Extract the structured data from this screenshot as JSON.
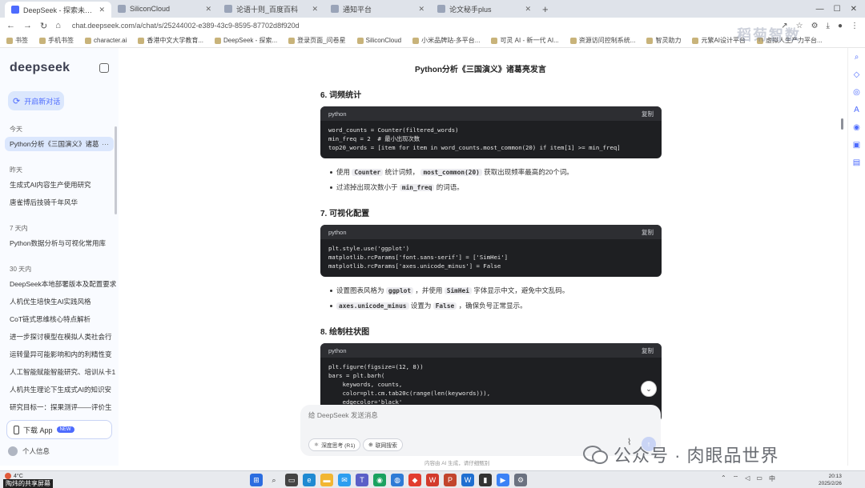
{
  "browser": {
    "tabs": [
      {
        "title": "DeepSeek - 探索未至之境",
        "active": true
      },
      {
        "title": "SiliconCloud",
        "active": false
      },
      {
        "title": "论语十则_百度百科",
        "active": false
      },
      {
        "title": "通知平台",
        "active": false
      },
      {
        "title": "论文秘手plus",
        "active": false
      }
    ],
    "tab_close": "✕",
    "new_tab": "+",
    "url": "chat.deepseek.com/a/chat/s/25244002-e389-43c9-8595-87702d8f920d",
    "bookmarks": [
      "书签",
      "手机书签",
      "character.ai",
      "香港中文大学教育...",
      "DeepSeek - 探索...",
      "登录页面_问卷星",
      "SiliconCloud",
      "小米品牌站-多平台...",
      "可灵 AI - 新一代 AI...",
      "资源访问控制系统...",
      "智灵助力",
      "元繁AI设计平台",
      "虚拟人生产力平台..."
    ],
    "watermark": "稻菊智数"
  },
  "sidebar": {
    "logo": "deepseek",
    "new_chat": "开启新对话",
    "sections": [
      {
        "label": "今天",
        "items": [
          "Python分析《三国演义》诸葛"
        ]
      },
      {
        "label": "昨天",
        "items": [
          "生成式AI内容生产使用研究",
          "唐雀博后技骑千年风华"
        ]
      },
      {
        "label": "7 天内",
        "items": [
          "Python数据分析与可视化常用库"
        ]
      },
      {
        "label": "30 天内",
        "items": [
          "DeepSeek本地部署版本及配置要求",
          "人机优生培快生AI实践风格",
          "CoT链式思维核心特点解析",
          "进一步探讨模型在模拟人类社会行",
          "运转量异可能影响和内的利精性变",
          "人工智能赋能智能研究、培训从卡1",
          "人机共生理论下生成式AI的知识安",
          "研究目标一：探果测评——评价生"
        ]
      }
    ],
    "more": "···",
    "download": "下载 App",
    "new_badge": "NEW",
    "profile": "个人信息"
  },
  "main": {
    "chat_title": "Python分析《三国演义》诸葛亮发言",
    "copy": "复制",
    "sections": [
      {
        "heading": "6. 词频统计",
        "lang": "python",
        "code": [
          "word_counts = Counter(filtered_words)",
          "min_freq = 2  # 最小出现次数",
          "top20_words = [item for item in word_counts.most_common(20) if item[1] >= min_freq]"
        ],
        "bullets": [
          {
            "pre": "使用 ",
            "code": "Counter",
            "mid": " 统计词频， ",
            "code2": "most_common(20)",
            "post": " 获取出现频率最高的20个词。"
          },
          {
            "pre": "过滤掉出现次数小于 ",
            "code": "min_freq",
            "mid": " 的词语。",
            "code2": "",
            "post": ""
          }
        ]
      },
      {
        "heading": "7. 可视化配置",
        "lang": "python",
        "code": [
          "plt.style.use('ggplot')",
          "matplotlib.rcParams['font.sans-serif'] = ['SimHei']",
          "matplotlib.rcParams['axes.unicode_minus'] = False"
        ],
        "bullets": [
          {
            "pre": "设置图表风格为 ",
            "code": "ggplot",
            "mid": " ，并使用 ",
            "code2": "SimHei",
            "post": " 字体显示中文，避免中文乱码。"
          },
          {
            "pre": "",
            "code": "axes.unicode_minus",
            "mid": " 设置为 ",
            "code2": "False",
            "post": " ，确保负号正常显示。"
          }
        ]
      },
      {
        "heading": "8. 绘制柱状图",
        "lang": "python",
        "code": [
          "plt.figure(figsize=(12, 8))",
          "bars = plt.barh(",
          "    keywords, counts,",
          "    color=plt.cm.tab20c(range(len(keywords))),",
          "    edgecolor='black'",
          ")"
        ]
      }
    ],
    "composer_placeholder": "给 DeepSeek 发送消息",
    "deep_think": "深度思考 (R1)",
    "web_search": "联网搜索",
    "footnote": "内容由 AI 生成，请仔细甄别"
  },
  "watermark_bottom": "公众号 · 肉眼品世界",
  "taskbar": {
    "weather": "4°C",
    "share_label": "陶炜的共享屏幕",
    "time": "20:13",
    "date": "2025/2/26"
  },
  "colors": {
    "accent": "#4d6bfe",
    "code_bg": "#1e1f22",
    "sidebar_bg": "#f9fbff"
  }
}
